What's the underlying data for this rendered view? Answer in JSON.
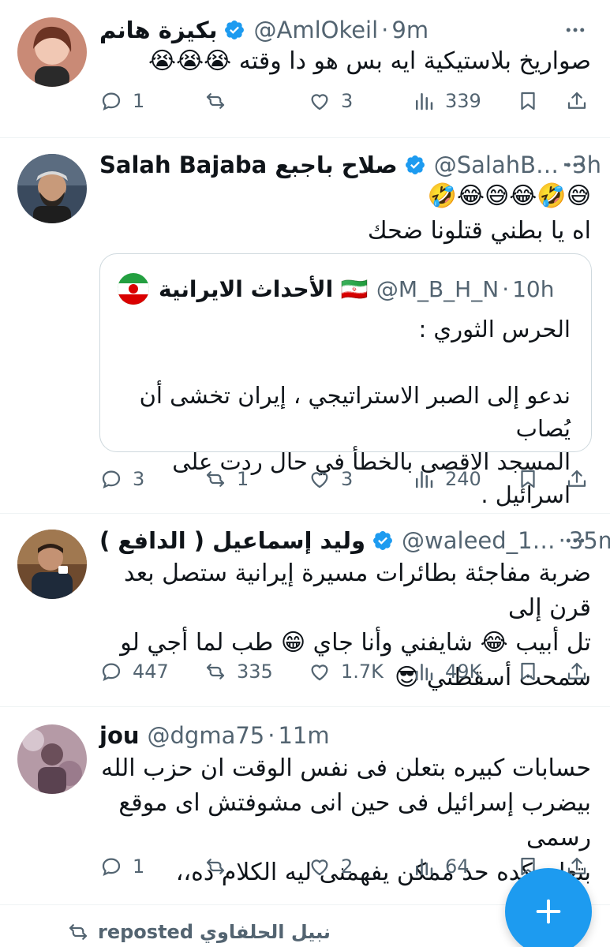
{
  "colors": {
    "accent": "#1d9bf0",
    "text_primary": "#0f1419",
    "text_secondary": "#536471",
    "border": "#cfd9de"
  },
  "tweets": [
    {
      "name": "بكيزة هانم",
      "handle": "@AmlOkeil",
      "time": "9m",
      "text_lines": [
        "صواريخ بلاستيكية ايه بس هو دا وقته 😭😭😭"
      ],
      "reply_count": "1",
      "retweet_count": "",
      "like_count": "3",
      "view_count": "339"
    },
    {
      "name": "Salah Bajaba صلاح باجبع",
      "handle": "@SalahB…",
      "time": "3h",
      "text_lines": [
        "🤣😂😅😂🤣😅",
        "اه يا بطني قتلونا ضحك"
      ],
      "quote": {
        "name": "الأحداث الايرانية 🇮🇷",
        "handle": "@M_B_H_N",
        "time": "10h",
        "text_lines": [
          "الحرس الثوري :",
          "",
          "ندعو إلى الصبر الاستراتيجي ، إيران تخشى أن يُصاب",
          "المسجد الاقصى بالخطأ في حال ردت على اسرائيل ."
        ]
      },
      "reply_count": "3",
      "retweet_count": "1",
      "like_count": "3",
      "view_count": "240"
    },
    {
      "name": "وليد إسماعيل ( الدافع )",
      "handle": "@waleed_1…",
      "time": "35m",
      "text_lines": [
        "ضربة مفاجئة بطائرات مسيرة إيرانية ستصل بعد قرن إلى",
        "تل أبيب 😂 شايفني وأنا جاي 😁 طب لما أجي لو",
        "سمحت أسقطني 😎"
      ],
      "reply_count": "447",
      "retweet_count": "335",
      "like_count": "1.7K",
      "view_count": "49K"
    },
    {
      "name": "jou",
      "handle": "@dgma75",
      "time": "11m",
      "text_lines": [
        "حسابات كبيره بتعلن فى نفس الوقت ان حزب الله",
        "بيضرب إسرائيل فى حين انى مشوفتش اى موقع رسمى",
        "بتعلن كده حد ممكن يفهمنى ليه الكلام ده،،"
      ],
      "reply_count": "1",
      "retweet_count": "",
      "like_count": "2",
      "view_count": "64"
    }
  ],
  "repost_banner": {
    "label": "reposted",
    "name": "نبيل الحلفاوي"
  },
  "icons": {
    "verified": "verified-badge-icon",
    "more": "more-dots-icon",
    "reply": "reply-icon",
    "retweet": "retweet-icon",
    "like": "heart-icon",
    "views": "views-icon",
    "bookmark": "bookmark-icon",
    "share": "share-icon",
    "compose": "plus-icon"
  }
}
